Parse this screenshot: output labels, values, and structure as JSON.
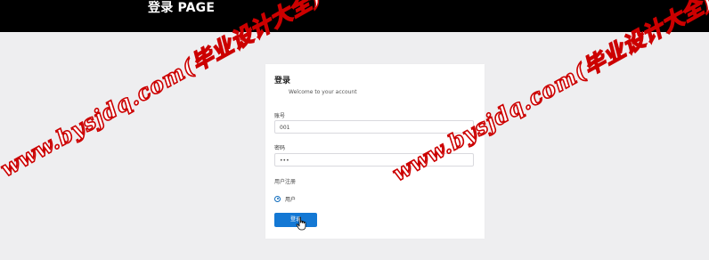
{
  "header": {
    "title": "登录 PAGE"
  },
  "login_card": {
    "title": "登录",
    "subtitle": "Welcome to your account",
    "account_label": "账号",
    "account_value": "001",
    "password_label": "密码",
    "password_value": "•••",
    "role_section_label": "用户注册",
    "role_option_label": "用户",
    "role_option_selected": true,
    "login_button_label": "登录"
  },
  "watermarks": [
    "www.bysjdq.com(毕业设计大全)",
    "www.bysjdq.com(毕业设计大全)"
  ],
  "colors": {
    "header_bg": "#000000",
    "page_bg": "#eeeef0",
    "button_bg": "#1478d4",
    "radio_accent": "#0f6cbd",
    "watermark_stroke": "#cc0000"
  },
  "icons": {
    "cursor": "hand-pointer-icon"
  }
}
